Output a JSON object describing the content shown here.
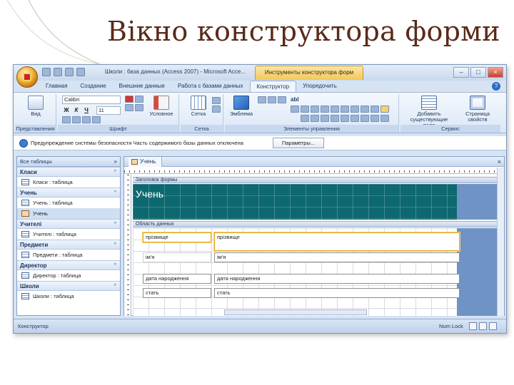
{
  "slide": {
    "title": "Вікно конструктора форми"
  },
  "window": {
    "title": "Школи : база данных (Access 2007) - Microsoft Acce...",
    "context_tab": "Инструменты конструктора форм"
  },
  "ribbon": {
    "tabs": [
      "Главная",
      "Создание",
      "Внешние данные",
      "Работа с базами данных",
      "Конструктор",
      "Упорядочить"
    ],
    "active_tab": "Конструктор",
    "groups": {
      "views": {
        "label": "Представления",
        "btn": "Вид"
      },
      "font": {
        "label": "Шрифт",
        "font_name": "Calibri",
        "font_size": "11",
        "cond_btn": "Условное",
        "format_btns": [
          "Ж",
          "К",
          "Ч"
        ]
      },
      "grid": {
        "label": "Сетка",
        "btn": "Сетка"
      },
      "controls": {
        "label": "Элементы управления",
        "logo_btn": "Эмблема",
        "abl": "abl"
      },
      "tools": {
        "label": "Сервис",
        "add_fields": "Добавить существующие поля",
        "property_sheet": "Страница свойств"
      }
    }
  },
  "security_bar": {
    "text": "Предупреждение системы безопасности   Часть содержимого базы данных отключена",
    "button": "Параметры..."
  },
  "nav": {
    "header": "Все таблицы",
    "groups": [
      {
        "name": "Класи",
        "items": [
          {
            "label": "Класи : таблица",
            "type": "table"
          }
        ]
      },
      {
        "name": "Учень",
        "items": [
          {
            "label": "Учень : таблица",
            "type": "table"
          },
          {
            "label": "Учень",
            "type": "form"
          }
        ]
      },
      {
        "name": "Учителі",
        "items": [
          {
            "label": "Учителі : таблица",
            "type": "table"
          }
        ]
      },
      {
        "name": "Предмети",
        "items": [
          {
            "label": "Предмети : таблица",
            "type": "table"
          }
        ]
      },
      {
        "name": "Директор",
        "items": [
          {
            "label": "Директор : таблица",
            "type": "table"
          }
        ]
      },
      {
        "name": "Школи",
        "items": [
          {
            "label": "Школи : таблица",
            "type": "table"
          }
        ]
      }
    ]
  },
  "document": {
    "tab": "Учень",
    "close": "×",
    "header_section": "Заголовок формы",
    "header_title": "Учень",
    "detail_section": "Область данных",
    "rows": [
      {
        "label": "прізвище",
        "field": "прізвище"
      },
      {
        "label": "ім'я",
        "field": "ім'я"
      },
      {
        "label": "дата народження",
        "field": "дата народження"
      },
      {
        "label": "стать",
        "field": "стать"
      }
    ]
  },
  "status": {
    "mode": "Конструктор",
    "num_lock": "Num Lock"
  },
  "colors": {
    "header_bg": "#0d6870",
    "selection": "#e4a51a",
    "ribbon": "#dbe7f6"
  }
}
